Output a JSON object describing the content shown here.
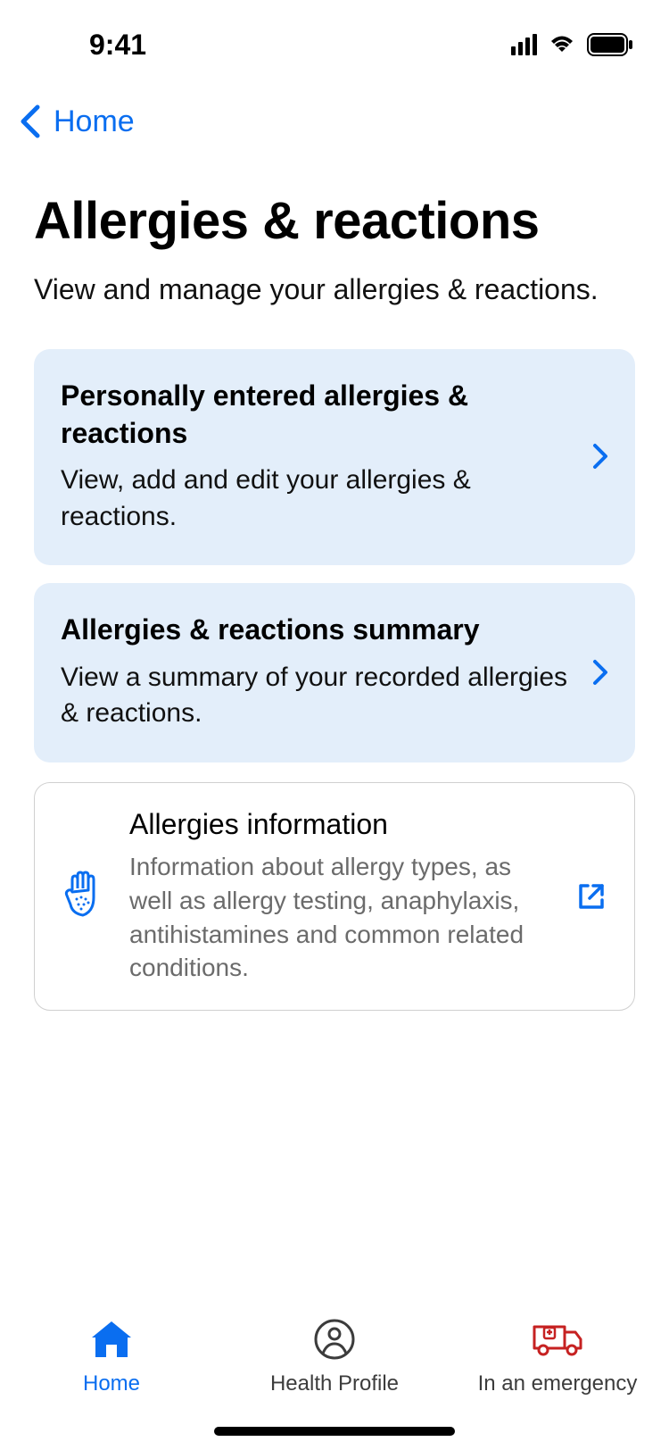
{
  "status": {
    "time": "9:41"
  },
  "nav": {
    "back_label": "Home"
  },
  "page": {
    "title": "Allergies & reactions",
    "subtitle": "View and manage your allergies & reactions."
  },
  "cards": [
    {
      "title": "Personally entered allergies & reactions",
      "desc": "View, add and edit your allergies & reactions."
    },
    {
      "title": "Allergies & reactions summary",
      "desc": "View a summary of your recorded allergies & reactions."
    }
  ],
  "info_card": {
    "title": "Allergies information",
    "desc": "Information about allergy types, as well as allergy testing, anaphylaxis, antihistamines and common related conditions."
  },
  "tabs": {
    "home": "Home",
    "profile": "Health Profile",
    "emergency": "In an emergency"
  }
}
